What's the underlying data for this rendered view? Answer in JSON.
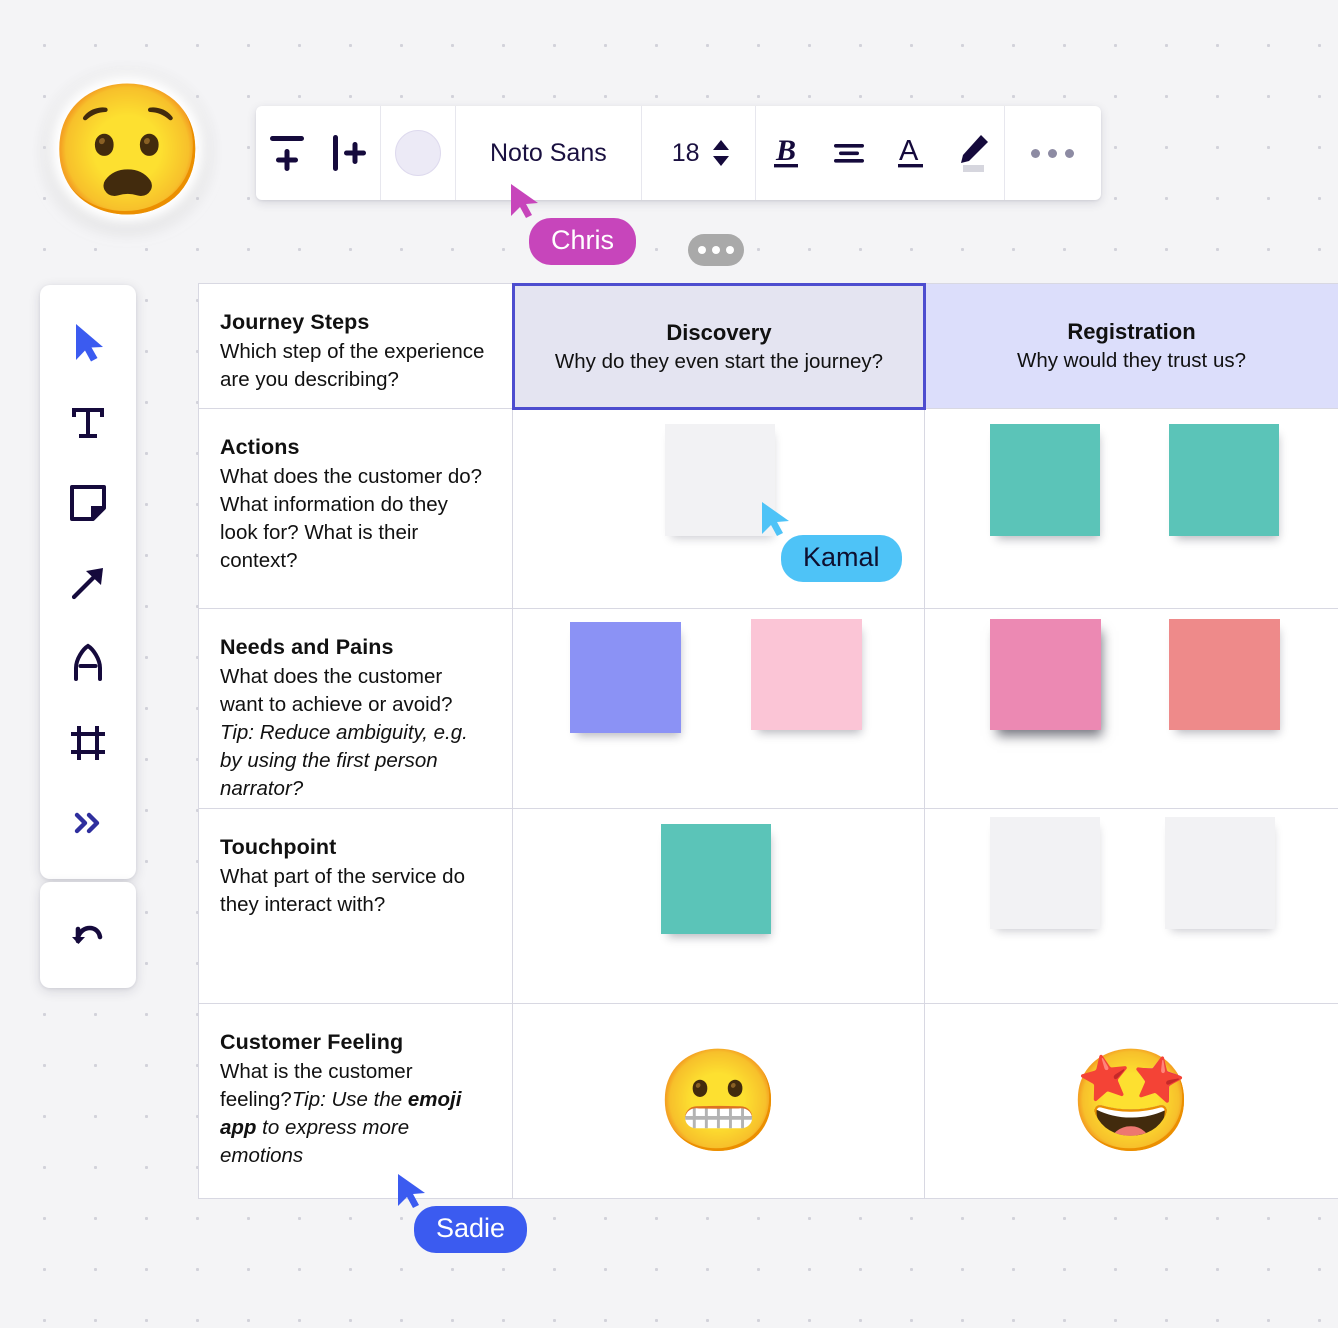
{
  "app": {
    "canvas_background": "#f4f4f6",
    "accent": "#4d4dcf"
  },
  "sticker": {
    "name": "astonished-face-sticker",
    "glyph": "😧"
  },
  "toolbar": {
    "add_row_label": "add-row",
    "add_column_label": "add-column",
    "color_swatch_value": "#eceaf6",
    "font_family_value": "Noto Sans",
    "font_size_value": "18",
    "bold_label": "B",
    "align_label": "align",
    "text_color_label": "A",
    "highlighter_label": "highlight",
    "more_label": "more-options"
  },
  "tool_rail": {
    "items": [
      {
        "icon": "select-cursor-icon",
        "label": "Select",
        "active": true
      },
      {
        "icon": "text-icon",
        "label": "Text",
        "active": false
      },
      {
        "icon": "sticky-note-icon",
        "label": "Sticky note",
        "active": false
      },
      {
        "icon": "arrow-connector-icon",
        "label": "Connector",
        "active": false
      },
      {
        "icon": "pen-shape-icon",
        "label": "Shape",
        "active": false
      },
      {
        "icon": "frame-icon",
        "label": "Frame",
        "active": false
      },
      {
        "icon": "more-tools-icon",
        "label": "More tools",
        "active": false
      }
    ],
    "undo_label": "Undo"
  },
  "journey_map": {
    "columns": [
      {
        "id": "journey-steps",
        "title": "Journey Steps",
        "subtitle": "Which step of the experience are you describing?"
      },
      {
        "id": "discovery",
        "title": "Discovery",
        "subtitle": "Why do they even start the journey?",
        "background": "#e4e4f1",
        "selected": true
      },
      {
        "id": "registration",
        "title": "Registration",
        "subtitle": "Why would they trust us?",
        "background": "#dcdefb",
        "selected": false
      }
    ],
    "rows": [
      {
        "id": "actions",
        "title": "Actions",
        "desc": "What does the customer do? What information do they look for? What is their context?",
        "notes": {
          "discovery": [
            {
              "color": "#f2f2f4"
            }
          ],
          "registration": [
            {
              "color": "#5bc4b8"
            },
            {
              "color": "#5bc4b8"
            }
          ]
        }
      },
      {
        "id": "needs-and-pains",
        "title": "Needs and Pains",
        "desc": "What does the customer want to achieve or avoid?",
        "tip": "Tip: Reduce ambiguity, e.g. by using the first person narrator?",
        "notes": {
          "discovery": [
            {
              "color": "#8b92f5"
            },
            {
              "color": "#fbc5d6"
            }
          ],
          "registration": [
            {
              "color": "#ec89b3"
            },
            {
              "color": "#ee8a8a"
            }
          ]
        }
      },
      {
        "id": "touchpoint",
        "title": "Touchpoint",
        "desc": "What part of the service do they interact with?",
        "notes": {
          "discovery": [
            {
              "color": "#5bc4b8"
            }
          ],
          "registration": [
            {
              "color": "#f2f2f4"
            },
            {
              "color": "#f2f2f4"
            }
          ]
        }
      },
      {
        "id": "customer-feeling",
        "title": "Customer Feeling",
        "desc": "What is the customer feeling?",
        "tip_italic": "Tip: Use the ",
        "tip_bold": "emoji app",
        "tip_italic_end": " to express more emotions",
        "emojis": {
          "discovery": "😬",
          "registration": "🤩"
        }
      }
    ]
  },
  "collaborators": [
    {
      "name": "Chris",
      "color": "#c745bb",
      "cursor": "magenta-cursor-icon"
    },
    {
      "name": "Kamal",
      "color": "#4ec3f7",
      "cursor": "cyan-cursor-icon"
    },
    {
      "name": "Sadie",
      "color": "#3b5bf0",
      "cursor": "blue-cursor-icon"
    }
  ],
  "typing_indicator": {
    "dots": 3,
    "color": "#a9a9a9"
  }
}
